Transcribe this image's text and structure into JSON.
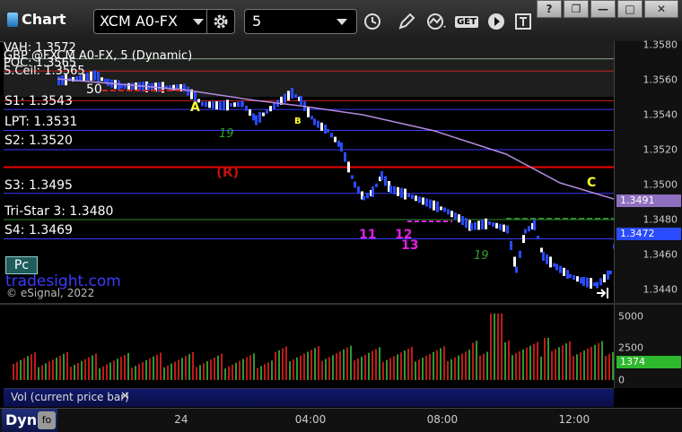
{
  "toolbar": {
    "app_title": "Chart",
    "symbol": "XCM A0-FX",
    "interval": "5",
    "get_label": "GET"
  },
  "window_controls": {
    "help": "?",
    "restore": "❐",
    "minimize": "—",
    "maximize": "□",
    "close": "✕"
  },
  "chart": {
    "header_lines": [
      "VAH: 1.3572",
      "GBP @FXCM A0-FX, 5 (Dynamic)",
      "POC: 1.3565",
      "S.Ceil: 1.3565"
    ],
    "levels": [
      {
        "label": "S1: 1.3543",
        "price": 1.3543,
        "color": "#3a3aff"
      },
      {
        "label": "LPT: 1.3531",
        "price": 1.3531,
        "color": "#3a3aff"
      },
      {
        "label": "S2: 1.3520",
        "price": 1.352,
        "color": "#3a3aff"
      },
      {
        "label": "S3: 1.3495",
        "price": 1.3495,
        "color": "#3a3aff"
      },
      {
        "label": "Tri-Star 3: 1.3480",
        "price": 1.348,
        "color": "#2e8b2e"
      },
      {
        "label": "S4: 1.3469",
        "price": 1.3469,
        "color": "#3a3aff"
      }
    ],
    "partial_label": "50",
    "pc_badge": "Pc",
    "watermark_site": "tradesight.com",
    "watermark_copy": "© eSignal, 2022",
    "annotations": {
      "A": "A",
      "B": "B",
      "C": "C",
      "R": "(R)",
      "n11": "11",
      "n13": "13",
      "n12": "12",
      "n19a": "19",
      "n19b": "19"
    },
    "price_axis": {
      "ticks": [
        "1.3580",
        "1.3560",
        "1.3540",
        "1.3520",
        "1.3500",
        "1.3480",
        "1.3460",
        "1.3440"
      ],
      "tick_values": [
        1.358,
        1.356,
        1.354,
        1.352,
        1.35,
        1.348,
        1.346,
        1.344
      ],
      "tag_ma": "1.3491",
      "tag_last": "1.3472",
      "tag_ma_value": 1.3491,
      "tag_last_value": 1.3472
    },
    "ma_color": "#b48ce0",
    "red_line_price": 1.351
  },
  "volume": {
    "axis_ticks": [
      "5000",
      "2500",
      "0"
    ],
    "axis_tick_values": [
      5000,
      2500,
      0
    ],
    "current": "1374",
    "current_value": 1374,
    "panel_label": "Vol (current price bar)",
    "close_glyph": "✕"
  },
  "time_axis": {
    "labels": [
      "24",
      "04:00",
      "08:00",
      "12:00"
    ],
    "positions": [
      0.291,
      0.503,
      0.719,
      0.935
    ]
  },
  "footer": {
    "dyn_label": "Dyn"
  }
}
